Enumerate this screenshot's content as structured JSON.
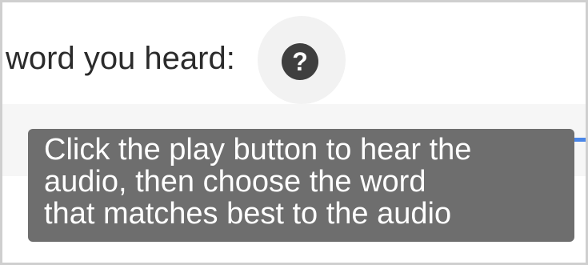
{
  "question": {
    "prompt": "word you heard:",
    "help_glyph": "?",
    "help_icon": "question-circle-icon"
  },
  "audio": {
    "progress_fraction": 1.0,
    "accent": "#4a86e8"
  },
  "tooltip": {
    "lines": [
      "Click the play button to hear the",
      "audio, then choose the word",
      "that matches best to the audio"
    ]
  }
}
